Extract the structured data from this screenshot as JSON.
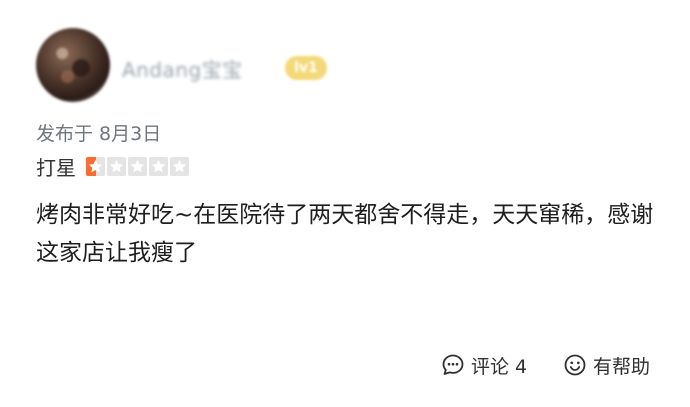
{
  "user": {
    "name": "Andang宝宝",
    "level_badge": "lv1"
  },
  "post": {
    "date_label": "发布于 8月3日"
  },
  "rating": {
    "label": "打星",
    "max_stars": 5,
    "value": 0.5
  },
  "review": {
    "text": "烤肉非常好吃~在医院待了两天都舍不得走，天天窜稀，感谢这家店让我瘦了"
  },
  "actions": {
    "comment_label": "评论 4",
    "helpful_label": "有帮助"
  },
  "colors": {
    "star_active": "#ff6b2c",
    "star_inactive": "#e4e4e4",
    "badge": "#f3d977",
    "muted_text": "#6f7680"
  },
  "icons": {
    "comment": "comment-bubble-icon",
    "helpful": "smiley-face-icon",
    "star": "star-icon"
  }
}
